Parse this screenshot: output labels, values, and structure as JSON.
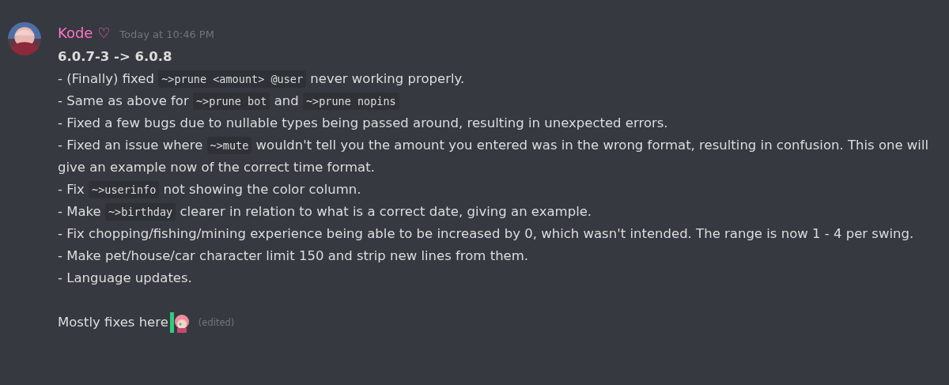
{
  "message": {
    "author": "Kode ♡",
    "timestamp": "Today at 10:46 PM",
    "heading": "6.0.7-3 -> 6.0.8",
    "lines": [
      {
        "segments": [
          {
            "kind": "text",
            "text": "- (Finally) fixed "
          },
          {
            "kind": "code",
            "text": "~>prune <amount> @user"
          },
          {
            "kind": "text",
            "text": " never working properly."
          }
        ]
      },
      {
        "segments": [
          {
            "kind": "text",
            "text": "- Same as above for "
          },
          {
            "kind": "code",
            "text": "~>prune bot"
          },
          {
            "kind": "text",
            "text": " and "
          },
          {
            "kind": "code",
            "text": "~>prune nopins"
          }
        ]
      },
      {
        "segments": [
          {
            "kind": "text",
            "text": "- Fixed a few bugs due to nullable types being passed around, resulting in unexpected errors."
          }
        ]
      },
      {
        "segments": [
          {
            "kind": "text",
            "text": "- Fixed an issue where "
          },
          {
            "kind": "code",
            "text": "~>mute"
          },
          {
            "kind": "text",
            "text": " wouldn't tell you the amount you entered was in the wrong format, resulting in confusion. This one will give an example now of the correct time format."
          }
        ]
      },
      {
        "segments": [
          {
            "kind": "text",
            "text": "- Fix "
          },
          {
            "kind": "code",
            "text": "~>userinfo"
          },
          {
            "kind": "text",
            "text": " not showing the color column."
          }
        ]
      },
      {
        "segments": [
          {
            "kind": "text",
            "text": "- Make "
          },
          {
            "kind": "code",
            "text": "~>birthday"
          },
          {
            "kind": "text",
            "text": " clearer in relation to what is a correct date, giving an example."
          }
        ]
      },
      {
        "segments": [
          {
            "kind": "text",
            "text": "- Fix chopping/fishing/mining experience being able to be increased by 0, which wasn't intended. The range is now 1 - 4 per swing."
          }
        ]
      },
      {
        "segments": [
          {
            "kind": "text",
            "text": "- Make pet/house/car character limit 150 and strip new lines from them."
          }
        ]
      },
      {
        "segments": [
          {
            "kind": "text",
            "text": "- Language updates."
          }
        ]
      }
    ],
    "footer": {
      "text": "Mostly fixes here",
      "edited": "(edited)"
    }
  }
}
